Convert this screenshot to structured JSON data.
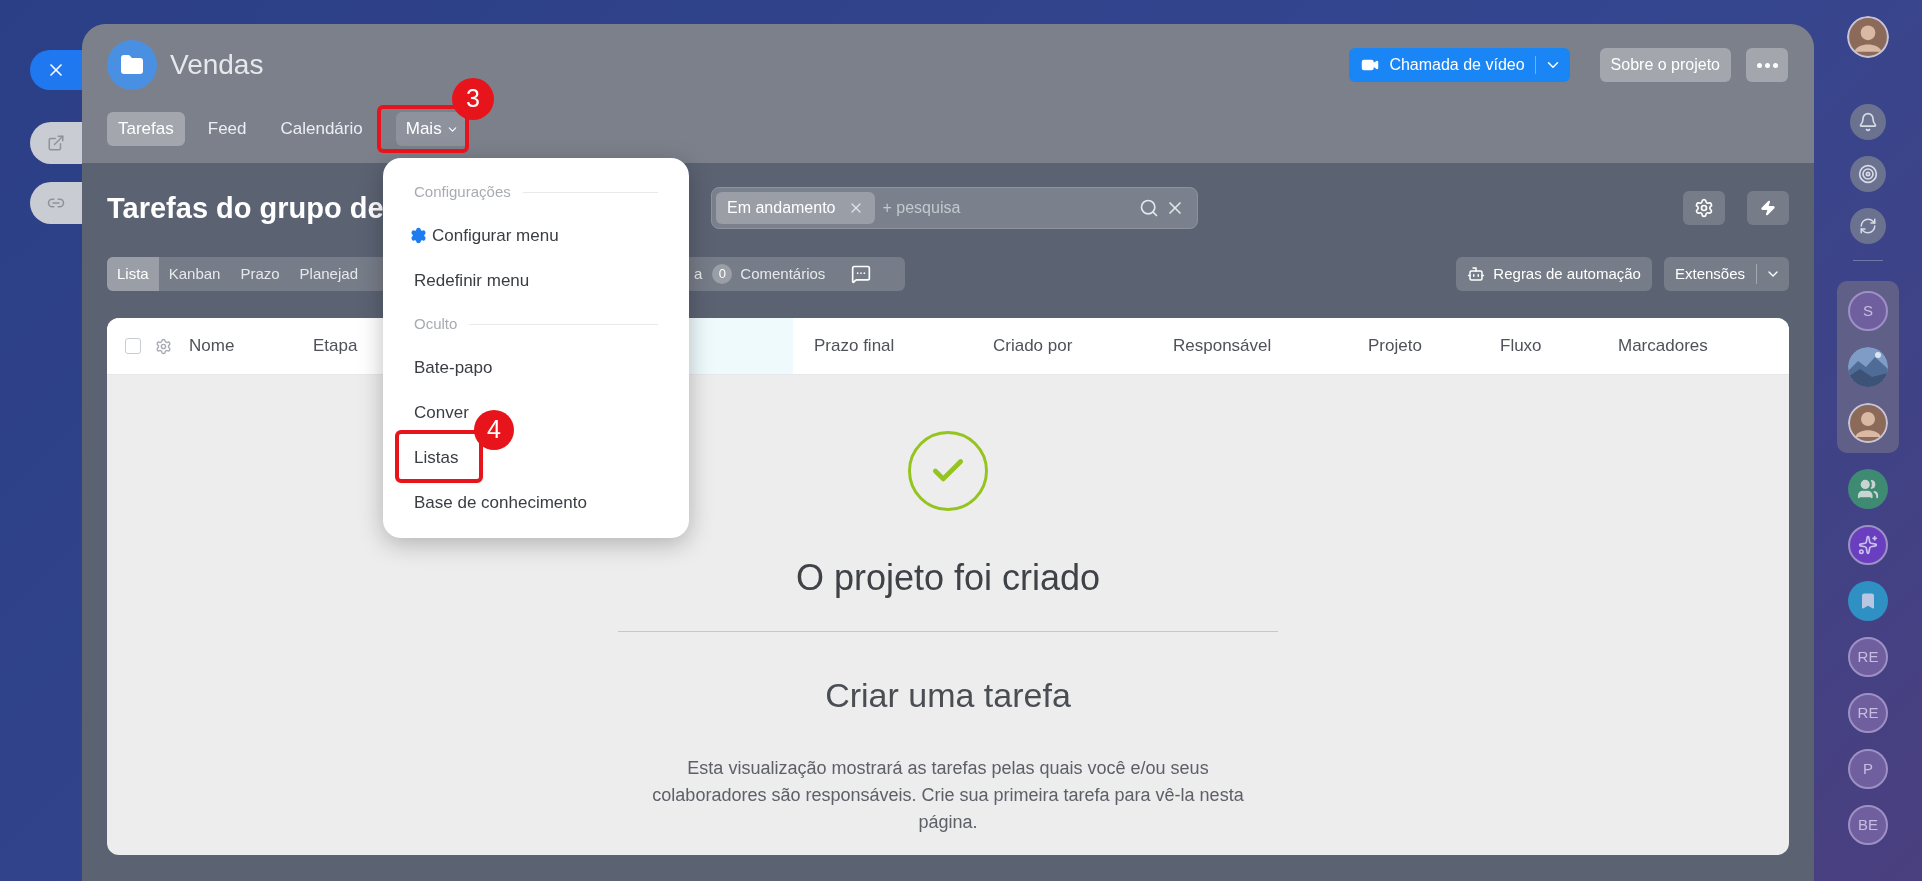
{
  "project": {
    "name": "Vendas"
  },
  "tabs": [
    {
      "label": "Tarefas",
      "selected": true,
      "kind": "link"
    },
    {
      "label": "Feed",
      "selected": false,
      "kind": "link"
    },
    {
      "label": "Calendário",
      "selected": false,
      "kind": "link"
    },
    {
      "label": "Mais",
      "selected": false,
      "kind": "dropdown"
    }
  ],
  "header_buttons": {
    "video_call": "Chamada de vídeo",
    "about": "Sobre o projeto"
  },
  "page_title": "Tarefas do grupo de",
  "filter": {
    "chips": [
      "Em andamento"
    ],
    "placeholder": "+ pesquisa"
  },
  "view_tabs": [
    {
      "label": "Lista",
      "selected": true
    },
    {
      "label": "Kanban",
      "selected": false
    },
    {
      "label": "Prazo",
      "selected": false
    },
    {
      "label": "Planejad",
      "selected": false
    }
  ],
  "view_tabs_after_menu": [
    {
      "label": "a",
      "selected": false
    }
  ],
  "comments": {
    "count": "0",
    "label": "Comentários"
  },
  "toolbar_buttons": {
    "automation": "Regras de automação",
    "extensions": "Extensões"
  },
  "table": {
    "select_all": {
      "checked": false
    },
    "columns": [
      "Nome",
      "Etapa",
      "Prazo final",
      "Criado por",
      "Responsável",
      "Projeto",
      "Fluxo",
      "Marcadores"
    ]
  },
  "empty_state": {
    "status": "O projeto foi criado",
    "heading": "Criar uma tarefa",
    "text": "Esta visualização mostrará as tarefas pelas quais você e/ou seus colaboradores são responsáveis. Crie sua primeira tarefa para vê-la nesta página."
  },
  "menu": {
    "sections": [
      {
        "title": "Configurações",
        "items": [
          {
            "label": "Configurar menu",
            "kind": "gear"
          },
          {
            "label": "Redefinir menu",
            "kind": "plain"
          }
        ]
      },
      {
        "title": "Oculto",
        "items": [
          {
            "label": "Bate-papo",
            "kind": "plain"
          },
          {
            "label": "Conver",
            "kind": "plain"
          },
          {
            "label": "Listas",
            "kind": "plain"
          },
          {
            "label": "Base de conhecimento",
            "kind": "plain"
          }
        ]
      }
    ]
  },
  "annotations": [
    {
      "number": "3"
    },
    {
      "number": "4"
    }
  ],
  "sidebar": {
    "tools": [
      {
        "kind": "bell"
      },
      {
        "kind": "target"
      },
      {
        "kind": "refresh"
      }
    ],
    "pinned": [
      {
        "kind": "initials",
        "text": "S"
      },
      {
        "kind": "picture"
      },
      {
        "kind": "person"
      }
    ],
    "chats": [
      {
        "kind": "group",
        "color": "#3e8a73"
      },
      {
        "kind": "spark",
        "color": "#6a3fbf"
      },
      {
        "kind": "bookmark",
        "color": "#2f90c4"
      },
      {
        "kind": "initials",
        "text": "RE"
      },
      {
        "kind": "initials",
        "text": "RE"
      },
      {
        "kind": "initials",
        "text": "P"
      },
      {
        "kind": "initials",
        "text": "BE"
      }
    ]
  }
}
